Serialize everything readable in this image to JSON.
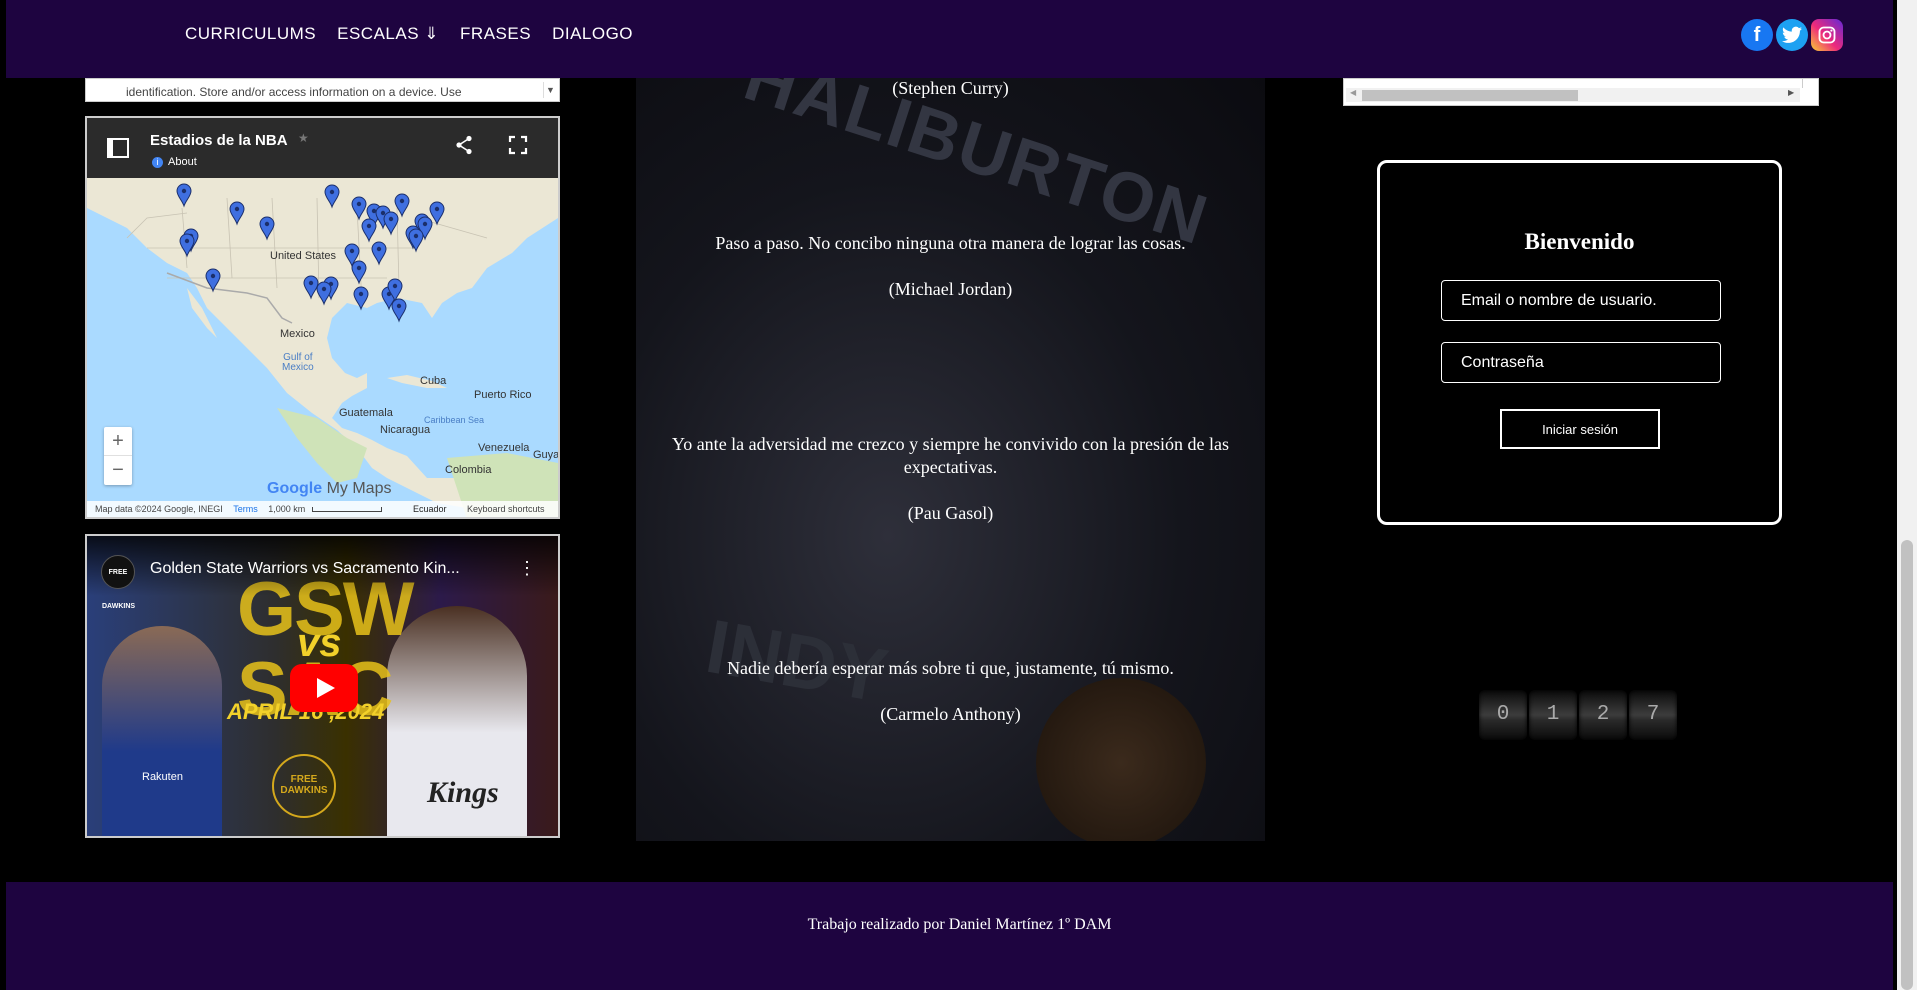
{
  "nav": {
    "items": [
      {
        "label": "CURRICULUMS"
      },
      {
        "label": "ESCALAS ⇓"
      },
      {
        "label": "FRASES"
      },
      {
        "label": "DIALOGO"
      }
    ]
  },
  "social": {
    "facebook_icon": "f",
    "twitter_icon": "🐦",
    "instagram_icon": "◎"
  },
  "consent": {
    "text": "identification. Store and/or access information on a device. Use",
    "dropdown": "▼"
  },
  "map": {
    "title": "Estadios de la NBA",
    "star": "★",
    "about": "About",
    "labels": {
      "us": "United States",
      "mexico": "Mexico",
      "gulf": "Gulf of\nMexico",
      "cuba": "Cuba",
      "pr": "Puerto Rico",
      "guatemala": "Guatemala",
      "nicaragua": "Nicaragua",
      "caribbean": "Caribbean Sea",
      "venezuela": "Venezuela",
      "colombia": "Colombia",
      "guya": "Guya"
    },
    "zoom_in": "+",
    "zoom_out": "−",
    "logo_google": "Google",
    "logo_mymaps": "My Maps",
    "footer": {
      "data": "Map data ©2024 Google, INEGI",
      "terms": "Terms",
      "scale": "1,000 km",
      "country": "Ecuador",
      "shortcuts": "Keyboard shortcuts"
    },
    "colors": {
      "land": "#ebe7d5",
      "water": "#aadaff",
      "pin": "#3f6fe0"
    }
  },
  "video": {
    "channel": "FREE DAWKINS",
    "title": "Golden State Warriors vs Sacramento Kin...",
    "menu": "⋮",
    "thumb_big1": "GSW",
    "thumb_vs": "vs",
    "thumb_big2": "SAC",
    "thumb_date": "APRIL 16 ,2024",
    "thumb_logo": "FREE DAWKINS",
    "jersey_left": "Rakuten",
    "jersey_right": "Kings"
  },
  "quotes": [
    {
      "text": "",
      "author": "(Stephen Curry)"
    },
    {
      "text": "Paso a paso. No concibo ninguna otra manera de lograr las cosas.",
      "author": "(Michael Jordan)"
    },
    {
      "text": "Yo ante la adversidad me crezco y siempre he convivido con la presión de las expectativas.",
      "author": "(Pau Gasol)"
    },
    {
      "text": "Nadie debería esperar más sobre ti que, justamente, tú mismo.",
      "author": "(Carmelo Anthony)"
    }
  ],
  "quotes_bg": {
    "jersey": "HALIBURTON",
    "indy": "INDY"
  },
  "login": {
    "title": "Bienvenido",
    "user_placeholder": "Email o nombre de usuario.",
    "pass_placeholder": "Contraseña",
    "submit": "Iniciar sesión"
  },
  "counter": {
    "digits": [
      "0",
      "1",
      "2",
      "7"
    ]
  },
  "footer": {
    "text": "Trabajo realizado por Daniel Martínez 1º DAM"
  }
}
